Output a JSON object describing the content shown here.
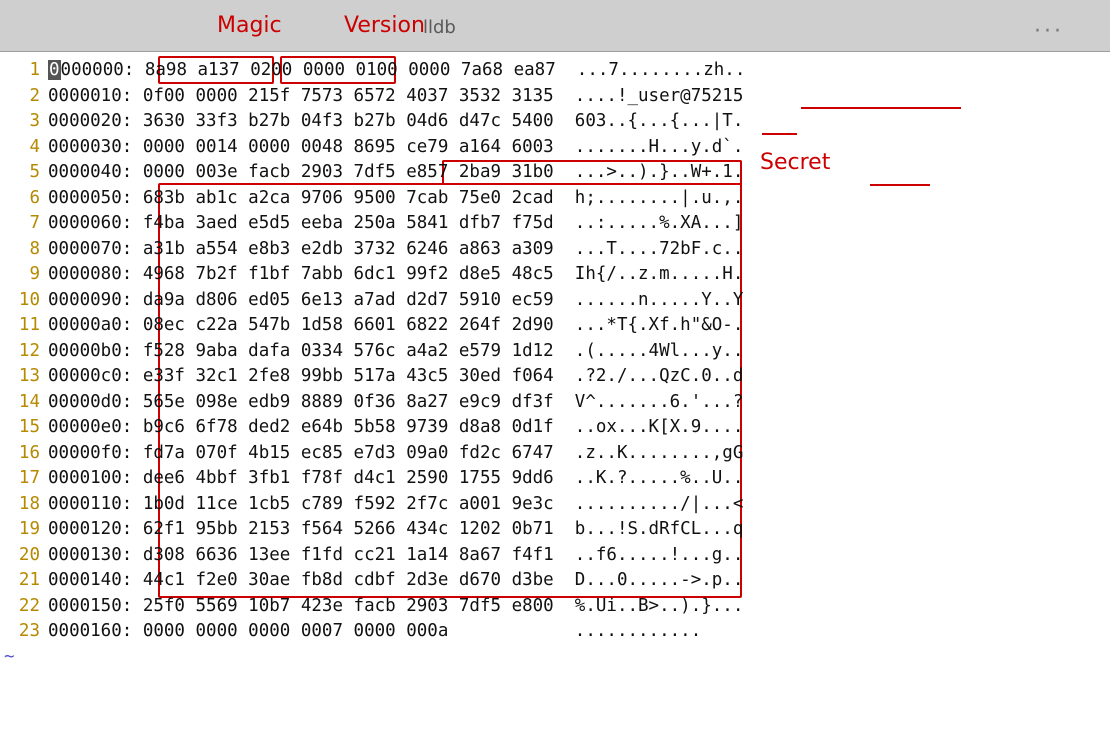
{
  "titlebar": {
    "label": "lldb",
    "more": "···"
  },
  "annotations": {
    "magic": "Magic",
    "version": "Version",
    "secret": "Secret"
  },
  "tilde": "~",
  "rows": [
    {
      "n": "1",
      "addr": "0000000:",
      "hex": "8a98 a137 0200 0000 0100 0000 7a68 ea87",
      "asc": "...7........zh.."
    },
    {
      "n": "2",
      "addr": "0000010:",
      "hex": "0f00 0000 215f 7573 6572 4037 3532 3135",
      "asc": "....!_user@75215"
    },
    {
      "n": "3",
      "addr": "0000020:",
      "hex": "3630 33f3 b27b 04f3 b27b 04d6 d47c 5400",
      "asc": "603..{...{...|T."
    },
    {
      "n": "4",
      "addr": "0000030:",
      "hex": "0000 0014 0000 0048 8695 ce79 a164 6003",
      "asc": ".......H...y.d`."
    },
    {
      "n": "5",
      "addr": "0000040:",
      "hex": "0000 003e facb 2903 7df5 e857 2ba9 31b0",
      "asc": "...>..).}..W+.1."
    },
    {
      "n": "6",
      "addr": "0000050:",
      "hex": "683b ab1c a2ca 9706 9500 7cab 75e0 2cad",
      "asc": "h;........|.u.,."
    },
    {
      "n": "7",
      "addr": "0000060:",
      "hex": "f4ba 3aed e5d5 eeba 250a 5841 dfb7 f75d",
      "asc": "..:.....%.XA...]"
    },
    {
      "n": "8",
      "addr": "0000070:",
      "hex": "a31b a554 e8b3 e2db 3732 6246 a863 a309",
      "asc": "...T....72bF.c.."
    },
    {
      "n": "9",
      "addr": "0000080:",
      "hex": "4968 7b2f f1bf 7abb 6dc1 99f2 d8e5 48c5",
      "asc": "Ih{/..z.m.....H."
    },
    {
      "n": "10",
      "addr": "0000090:",
      "hex": "da9a d806 ed05 6e13 a7ad d2d7 5910 ec59",
      "asc": "......n.....Y..Y"
    },
    {
      "n": "11",
      "addr": "00000a0:",
      "hex": "08ec c22a 547b 1d58 6601 6822 264f 2d90",
      "asc": "...*T{.Xf.h\"&O-."
    },
    {
      "n": "12",
      "addr": "00000b0:",
      "hex": "f528 9aba dafa 0334 576c a4a2 e579 1d12",
      "asc": ".(.....4Wl...y.."
    },
    {
      "n": "13",
      "addr": "00000c0:",
      "hex": "e33f 32c1 2fe8 99bb 517a 43c5 30ed f064",
      "asc": ".?2./...QzC.0..d"
    },
    {
      "n": "14",
      "addr": "00000d0:",
      "hex": "565e 098e edb9 8889 0f36 8a27 e9c9 df3f",
      "asc": "V^.......6.'...?"
    },
    {
      "n": "15",
      "addr": "00000e0:",
      "hex": "b9c6 6f78 ded2 e64b 5b58 9739 d8a8 0d1f",
      "asc": "..ox...K[X.9...."
    },
    {
      "n": "16",
      "addr": "00000f0:",
      "hex": "fd7a 070f 4b15 ec85 e7d3 09a0 fd2c 6747",
      "asc": ".z..K........,gG"
    },
    {
      "n": "17",
      "addr": "0000100:",
      "hex": "dee6 4bbf 3fb1 f78f d4c1 2590 1755 9dd6",
      "asc": "..K.?.....%..U.."
    },
    {
      "n": "18",
      "addr": "0000110:",
      "hex": "1b0d 11ce 1cb5 c789 f592 2f7c a001 9e3c",
      "asc": "........../|...<"
    },
    {
      "n": "19",
      "addr": "0000120:",
      "hex": "62f1 95bb 2153 f564 5266 434c 1202 0b71",
      "asc": "b...!S.dRfCL...q"
    },
    {
      "n": "20",
      "addr": "0000130:",
      "hex": "d308 6636 13ee f1fd cc21 1a14 8a67 f4f1",
      "asc": "..f6.....!...g.."
    },
    {
      "n": "21",
      "addr": "0000140:",
      "hex": "44c1 f2e0 30ae fb8d cdbf 2d3e d670 d3be",
      "asc": "D...0.....->.p.."
    },
    {
      "n": "22",
      "addr": "0000150:",
      "hex": "25f0 5569 10b7 423e facb 2903 7df5 e800",
      "asc": "%.Ui..B>..).}..."
    },
    {
      "n": "23",
      "addr": "0000160:",
      "hex": "0000 0000 0000 0007 0000 000a          ",
      "asc": "............"
    }
  ]
}
